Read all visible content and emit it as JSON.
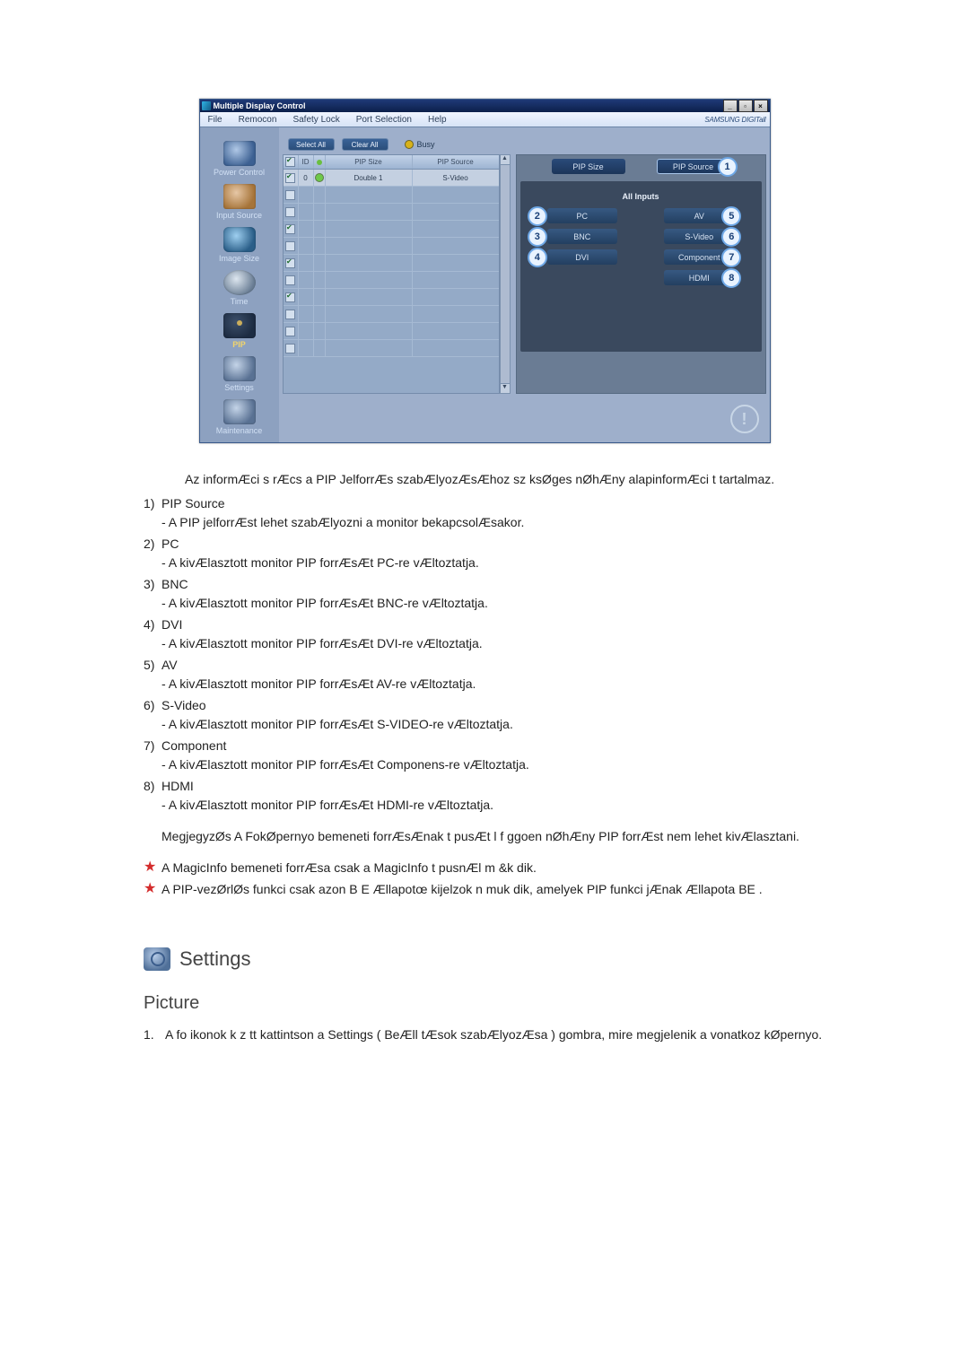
{
  "window": {
    "title": "Multiple Display Control",
    "menus": [
      "File",
      "Remocon",
      "Safety Lock",
      "Port Selection",
      "Help"
    ],
    "brand": "SAMSUNG DIGITall"
  },
  "sidebar": {
    "items": [
      {
        "label": "Power Control"
      },
      {
        "label": "Input Source"
      },
      {
        "label": "Image Size"
      },
      {
        "label": "Time"
      },
      {
        "label": "PIP"
      },
      {
        "label": "Settings"
      },
      {
        "label": "Maintenance"
      }
    ]
  },
  "toolbar": {
    "select_all": "Select All",
    "clear_all": "Clear All",
    "busy": "Busy"
  },
  "grid": {
    "headers": {
      "id": "ID",
      "pip_size": "PIP Size",
      "pip_source": "PIP Source"
    },
    "rows": [
      {
        "checked": true,
        "id": "0",
        "green": true,
        "pip_size": "Double 1",
        "pip_source": "S-Video"
      },
      {
        "checked": false
      },
      {
        "checked": false
      },
      {
        "checked": true
      },
      {
        "checked": false
      },
      {
        "checked": true
      },
      {
        "checked": false
      },
      {
        "checked": true
      },
      {
        "checked": false
      },
      {
        "checked": false
      },
      {
        "checked": false
      }
    ]
  },
  "control": {
    "tabs": {
      "pip_size": "PIP Size",
      "pip_source": "PIP Source"
    },
    "section": "All Inputs",
    "buttons": {
      "pc": "PC",
      "bnc": "BNC",
      "dvi": "DVI",
      "av": "AV",
      "s_video": "S-Video",
      "component": "Component",
      "hdmi": "HDMI"
    },
    "badges": {
      "pip_source": "1",
      "pc": "2",
      "bnc": "3",
      "dvi": "4",
      "av": "5",
      "s_video": "6",
      "component": "7",
      "hdmi": "8"
    }
  },
  "doc": {
    "intro": "Az informÆci s rÆcs a PIP JelforrÆs szabÆlyozÆsÆhoz sz ksØges nØhÆny alapinformÆci t tartalmaz.",
    "items": [
      {
        "n": "1)",
        "title": "PIP Source",
        "desc": "- A PIP jelforrÆst lehet szabÆlyozni a monitor bekapcsolÆsakor."
      },
      {
        "n": "2)",
        "title": "PC",
        "desc": "- A kivÆlasztott monitor PIP forrÆsÆt PC-re vÆltoztatja."
      },
      {
        "n": "3)",
        "title": "BNC",
        "desc": "- A kivÆlasztott monitor PIP forrÆsÆt BNC-re vÆltoztatja."
      },
      {
        "n": "4)",
        "title": "DVI",
        "desc": "- A kivÆlasztott monitor PIP forrÆsÆt DVI-re vÆltoztatja."
      },
      {
        "n": "5)",
        "title": "AV",
        "desc": "- A kivÆlasztott monitor PIP forrÆsÆt AV-re vÆltoztatja."
      },
      {
        "n": "6)",
        "title": "S-Video",
        "desc": "- A kivÆlasztott monitor PIP forrÆsÆt S-VIDEO-re vÆltoztatja."
      },
      {
        "n": "7)",
        "title": "Component",
        "desc": "- A kivÆlasztott monitor PIP forrÆsÆt Componens-re vÆltoztatja."
      },
      {
        "n": "8)",
        "title": "HDMI",
        "desc": "- A kivÆlasztott monitor PIP forrÆsÆt HDMI-re vÆltoztatja."
      }
    ],
    "note": "MegjegyzØs A FokØpernyo bemeneti forrÆsÆnak t pusÆt l f ggoen nØhÆny PIP forrÆst nem lehet kivÆlasztani.",
    "star1": "A MagicInfo bemeneti forrÆsa csak a MagicInfo t pusnÆl m &k dik.",
    "star2": "A PIP-vezØrlØs funkci  csak azon  B      E  Ællapotœ kijelzok n muk dik,       amelyek PIP funkci jÆnak Ællapota  BE .",
    "settings_heading": "Settings",
    "picture_heading": "Picture",
    "picture_step": {
      "n": "1.",
      "text": "A fo ikonok k z tt kattintson a  Settings  ( BeÆll tÆsok szabÆlyozÆsa ) gombra, mire megjelenik a vonatkoz  kØpernyo."
    }
  }
}
